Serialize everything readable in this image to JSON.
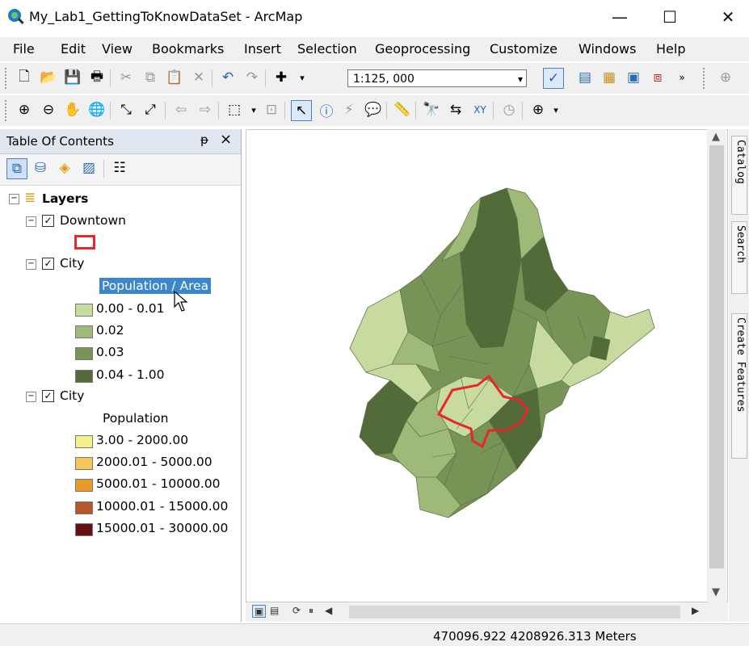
{
  "window": {
    "title": "My_Lab1_GettingToKnowDataSet - ArcMap",
    "minimize": "—",
    "maximize": "☐",
    "close": "✕"
  },
  "menu": [
    "File",
    "Edit",
    "View",
    "Bookmarks",
    "Insert",
    "Selection",
    "Geoprocessing",
    "Customize",
    "Windows",
    "Help"
  ],
  "toolbar": {
    "scale": "1:125, 000"
  },
  "toc": {
    "title": "Table Of Contents",
    "pin": " 4",
    "close": "×",
    "root": "Layers",
    "layers": [
      {
        "name": "Downtown",
        "checked": true
      },
      {
        "name": "City",
        "checked": true,
        "field": "Population / Area",
        "classes": [
          {
            "label": "0.00 - 0.01",
            "color": "#c7dba0"
          },
          {
            "label": "0.02",
            "color": "#9fb979"
          },
          {
            "label": "0.03",
            "color": "#779356"
          },
          {
            "label": "0.04 - 1.00",
            "color": "#526b38"
          }
        ]
      },
      {
        "name": "City",
        "checked": true,
        "field": "Population",
        "classes": [
          {
            "label": "3.00 - 2000.00",
            "color": "#f6f08a"
          },
          {
            "label": "2000.01 - 5000.00",
            "color": "#f6c75a"
          },
          {
            "label": "5000.01 - 10000.00",
            "color": "#eb9a2a"
          },
          {
            "label": "10000.01 - 15000.00",
            "color": "#b4582a"
          },
          {
            "label": "15000.01 - 30000.00",
            "color": "#6b0f10"
          }
        ]
      }
    ]
  },
  "sidetabs": [
    "Catalog",
    "Search",
    "Create Features"
  ],
  "status": {
    "coordinates": "470096.922  4208926.313 Meters"
  },
  "colors": {
    "downtown_outline": "#e8262b",
    "selection": "#3c86cc",
    "toc_header": "#dfe7f1"
  }
}
